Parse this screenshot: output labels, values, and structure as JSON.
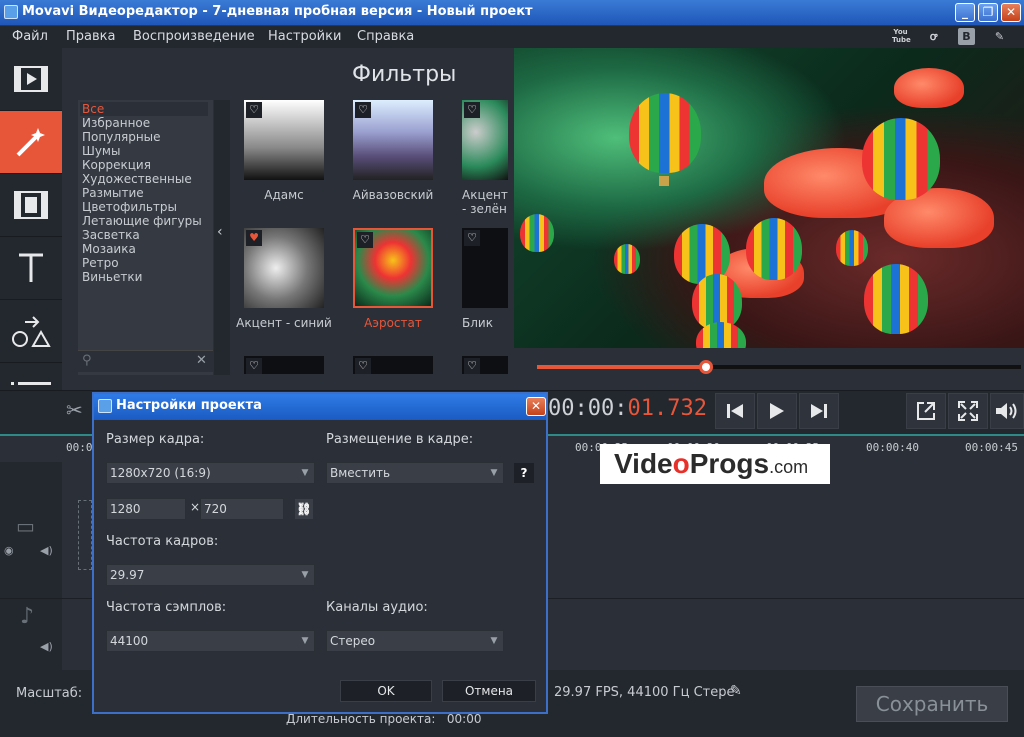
{
  "window": {
    "title": "Movavi Видеоредактор - 7-дневная пробная версия - Новый проект",
    "minimize": "_",
    "maximize": "❐",
    "close": "✕"
  },
  "menu": [
    "Файл",
    "Правка",
    "Воспроизведение",
    "Настройки",
    "Справка"
  ],
  "social": {
    "youtube": "You\nTube",
    "ok": "ꝍ",
    "vk": "B",
    "chat": "✎"
  },
  "tools": [
    "video-icon",
    "magic-wand-icon",
    "film-icon",
    "text-icon",
    "shapes-icon",
    "list-icon"
  ],
  "filters": {
    "heading": "Фильтры",
    "categories": [
      "Все",
      "Избранное",
      "Популярные",
      "Шумы",
      "Коррекция",
      "Художественные",
      "Размытие",
      "Цветофильтры",
      "Летающие фигуры",
      "Засветка",
      "Мозаика",
      "Ретро",
      "Виньетки"
    ],
    "selected_category": "Все",
    "items": [
      {
        "label": "Адамс"
      },
      {
        "label": "Айвазовский"
      },
      {
        "label": "Акцент - зелён"
      },
      {
        "label": "Акцент - синий"
      },
      {
        "label": "Аэростат"
      },
      {
        "label": "Блик"
      }
    ],
    "selected_item": "Аэростат"
  },
  "player": {
    "progress": 0.35,
    "timecode_prefix": "00:00:",
    "timecode_value": "01.732"
  },
  "timeline": {
    "ticks": [
      "00:0",
      "00:00:25",
      "00:00:30",
      "00:00:35",
      "00:00:40",
      "00:00:45"
    ]
  },
  "watermark": {
    "video": "Vide",
    "o": "o",
    "progs": "Progs",
    "com": ".com"
  },
  "bottom": {
    "scale_label": "Масштаб:",
    "fps_info": "29.97 FPS, 44100 Гц Стере",
    "duration_label": "Длительность проекта:",
    "duration_value": "00:00",
    "save_button": "Сохранить"
  },
  "dialog": {
    "title": "Настройки проекта",
    "frame_size_label": "Размер кадра:",
    "frame_size_value": "1280x720 (16:9)",
    "placement_label": "Размещение в кадре:",
    "placement_value": "Вместить",
    "help": "?",
    "width_value": "1280",
    "x_sep": "×",
    "height_value": "720",
    "fps_label": "Частота кадров:",
    "fps_value": "29.97",
    "sample_label": "Частота сэмплов:",
    "sample_value": "44100",
    "channels_label": "Каналы аудио:",
    "channels_value": "Стерео",
    "ok": "OK",
    "cancel": "Отмена"
  }
}
